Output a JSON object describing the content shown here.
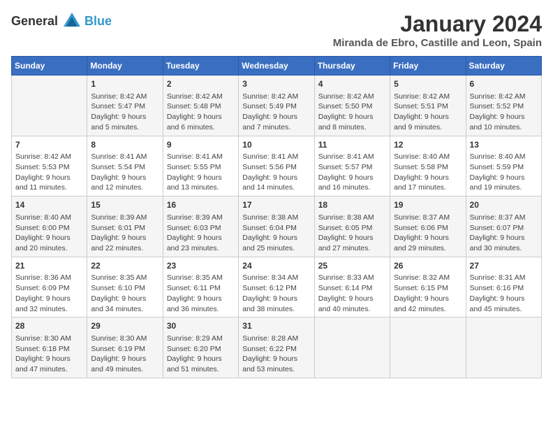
{
  "logo": {
    "general": "General",
    "blue": "Blue"
  },
  "title": "January 2024",
  "location": "Miranda de Ebro, Castille and Leon, Spain",
  "days_header": [
    "Sunday",
    "Monday",
    "Tuesday",
    "Wednesday",
    "Thursday",
    "Friday",
    "Saturday"
  ],
  "weeks": [
    [
      {
        "day": "",
        "content": ""
      },
      {
        "day": "1",
        "content": "Sunrise: 8:42 AM\nSunset: 5:47 PM\nDaylight: 9 hours\nand 5 minutes."
      },
      {
        "day": "2",
        "content": "Sunrise: 8:42 AM\nSunset: 5:48 PM\nDaylight: 9 hours\nand 6 minutes."
      },
      {
        "day": "3",
        "content": "Sunrise: 8:42 AM\nSunset: 5:49 PM\nDaylight: 9 hours\nand 7 minutes."
      },
      {
        "day": "4",
        "content": "Sunrise: 8:42 AM\nSunset: 5:50 PM\nDaylight: 9 hours\nand 8 minutes."
      },
      {
        "day": "5",
        "content": "Sunrise: 8:42 AM\nSunset: 5:51 PM\nDaylight: 9 hours\nand 9 minutes."
      },
      {
        "day": "6",
        "content": "Sunrise: 8:42 AM\nSunset: 5:52 PM\nDaylight: 9 hours\nand 10 minutes."
      }
    ],
    [
      {
        "day": "7",
        "content": "Sunrise: 8:42 AM\nSunset: 5:53 PM\nDaylight: 9 hours\nand 11 minutes."
      },
      {
        "day": "8",
        "content": "Sunrise: 8:41 AM\nSunset: 5:54 PM\nDaylight: 9 hours\nand 12 minutes."
      },
      {
        "day": "9",
        "content": "Sunrise: 8:41 AM\nSunset: 5:55 PM\nDaylight: 9 hours\nand 13 minutes."
      },
      {
        "day": "10",
        "content": "Sunrise: 8:41 AM\nSunset: 5:56 PM\nDaylight: 9 hours\nand 14 minutes."
      },
      {
        "day": "11",
        "content": "Sunrise: 8:41 AM\nSunset: 5:57 PM\nDaylight: 9 hours\nand 16 minutes."
      },
      {
        "day": "12",
        "content": "Sunrise: 8:40 AM\nSunset: 5:58 PM\nDaylight: 9 hours\nand 17 minutes."
      },
      {
        "day": "13",
        "content": "Sunrise: 8:40 AM\nSunset: 5:59 PM\nDaylight: 9 hours\nand 19 minutes."
      }
    ],
    [
      {
        "day": "14",
        "content": "Sunrise: 8:40 AM\nSunset: 6:00 PM\nDaylight: 9 hours\nand 20 minutes."
      },
      {
        "day": "15",
        "content": "Sunrise: 8:39 AM\nSunset: 6:01 PM\nDaylight: 9 hours\nand 22 minutes."
      },
      {
        "day": "16",
        "content": "Sunrise: 8:39 AM\nSunset: 6:03 PM\nDaylight: 9 hours\nand 23 minutes."
      },
      {
        "day": "17",
        "content": "Sunrise: 8:38 AM\nSunset: 6:04 PM\nDaylight: 9 hours\nand 25 minutes."
      },
      {
        "day": "18",
        "content": "Sunrise: 8:38 AM\nSunset: 6:05 PM\nDaylight: 9 hours\nand 27 minutes."
      },
      {
        "day": "19",
        "content": "Sunrise: 8:37 AM\nSunset: 6:06 PM\nDaylight: 9 hours\nand 29 minutes."
      },
      {
        "day": "20",
        "content": "Sunrise: 8:37 AM\nSunset: 6:07 PM\nDaylight: 9 hours\nand 30 minutes."
      }
    ],
    [
      {
        "day": "21",
        "content": "Sunrise: 8:36 AM\nSunset: 6:09 PM\nDaylight: 9 hours\nand 32 minutes."
      },
      {
        "day": "22",
        "content": "Sunrise: 8:35 AM\nSunset: 6:10 PM\nDaylight: 9 hours\nand 34 minutes."
      },
      {
        "day": "23",
        "content": "Sunrise: 8:35 AM\nSunset: 6:11 PM\nDaylight: 9 hours\nand 36 minutes."
      },
      {
        "day": "24",
        "content": "Sunrise: 8:34 AM\nSunset: 6:12 PM\nDaylight: 9 hours\nand 38 minutes."
      },
      {
        "day": "25",
        "content": "Sunrise: 8:33 AM\nSunset: 6:14 PM\nDaylight: 9 hours\nand 40 minutes."
      },
      {
        "day": "26",
        "content": "Sunrise: 8:32 AM\nSunset: 6:15 PM\nDaylight: 9 hours\nand 42 minutes."
      },
      {
        "day": "27",
        "content": "Sunrise: 8:31 AM\nSunset: 6:16 PM\nDaylight: 9 hours\nand 45 minutes."
      }
    ],
    [
      {
        "day": "28",
        "content": "Sunrise: 8:30 AM\nSunset: 6:18 PM\nDaylight: 9 hours\nand 47 minutes."
      },
      {
        "day": "29",
        "content": "Sunrise: 8:30 AM\nSunset: 6:19 PM\nDaylight: 9 hours\nand 49 minutes."
      },
      {
        "day": "30",
        "content": "Sunrise: 8:29 AM\nSunset: 6:20 PM\nDaylight: 9 hours\nand 51 minutes."
      },
      {
        "day": "31",
        "content": "Sunrise: 8:28 AM\nSunset: 6:22 PM\nDaylight: 9 hours\nand 53 minutes."
      },
      {
        "day": "",
        "content": ""
      },
      {
        "day": "",
        "content": ""
      },
      {
        "day": "",
        "content": ""
      }
    ]
  ]
}
